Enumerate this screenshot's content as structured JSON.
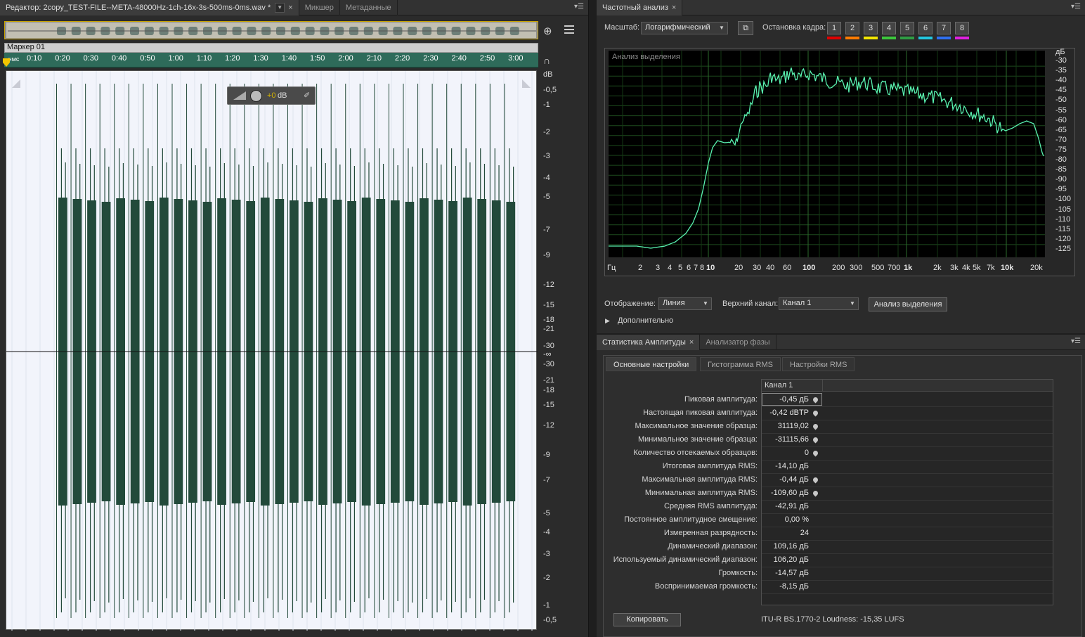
{
  "editor": {
    "tab_title": "Редактор: 2copy_TEST-FILE--META-48000Hz-1ch-16x-3s-500ms-0ms.wav *",
    "tabs": [
      "Микшер",
      "Метаданные"
    ],
    "marker": "Маркер 01",
    "time_unit": "чмс",
    "time_ticks": [
      "0:10",
      "0:20",
      "0:30",
      "0:40",
      "0:50",
      "1:00",
      "1:10",
      "1:20",
      "1:30",
      "1:40",
      "1:50",
      "2:00",
      "2:10",
      "2:20",
      "2:30",
      "2:40",
      "2:50",
      "3:00"
    ],
    "db_unit": "dB",
    "db_ticks": [
      "-0,5",
      "-1",
      "-2",
      "-3",
      "-4",
      "-5",
      "-7",
      "-9",
      "-12",
      "-15",
      "-18",
      "-21",
      "-30",
      "-∞",
      "-30",
      "-21",
      "-18",
      "-15",
      "-12",
      "-9",
      "-7",
      "-5",
      "-4",
      "-3",
      "-2",
      "-1",
      "-0,5"
    ],
    "hud_value": "+0",
    "hud_unit": "dB",
    "waveform_color": "#234a3b",
    "timeline_color": "#2e6b5a"
  },
  "freq": {
    "tab": "Частотный анализ",
    "scale_label": "Масштаб:",
    "scale_value": "Логарифмический",
    "freeze_label": "Остановка кадра:",
    "freeze_buttons": [
      "1",
      "2",
      "3",
      "4",
      "5",
      "6",
      "7",
      "8"
    ],
    "freeze_colors": [
      "#e00000",
      "#ff7b00",
      "#f2e600",
      "#3cc83c",
      "#2f9e44",
      "#22c7e0",
      "#2f6ff0",
      "#e020e0"
    ],
    "plot_title": "Анализ выделения",
    "y_unit": "дБ",
    "y_ticks": [
      "-30",
      "-35",
      "-40",
      "-45",
      "-50",
      "-55",
      "-60",
      "-65",
      "-70",
      "-75",
      "-80",
      "-85",
      "-90",
      "-95",
      "-100",
      "-105",
      "-110",
      "-115",
      "-120",
      "-125"
    ],
    "x_unit": "Гц",
    "x_ticks": [
      "2",
      "3",
      "4",
      "5",
      "6",
      "7",
      "8",
      "10",
      "20",
      "30",
      "40",
      "60",
      "100",
      "200",
      "300",
      "500",
      "700",
      "1k",
      "2k",
      "3k",
      "4k",
      "5k",
      "7k",
      "10k",
      "20k"
    ],
    "display_label": "Отображение:",
    "display_value": "Линия",
    "channel_label": "Верхний канал:",
    "channel_value": "Канал 1",
    "analyze_button": "Анализ выделения",
    "advanced": "Дополнительно",
    "line_color": "#59f2b0"
  },
  "stats": {
    "tabs": [
      "Статистика Амплитуды",
      "Анализатор фазы"
    ],
    "subtabs": [
      "Основные настройки",
      "Гистограмма RMS",
      "Настройки RMS"
    ],
    "column": "Канал 1",
    "rows": [
      {
        "label": "Пиковая амплитуда:",
        "value": "-0,45 дБ",
        "dot": true
      },
      {
        "label": "Настоящая пиковая амплитуда:",
        "value": "-0,42 dBTP",
        "dot": true
      },
      {
        "label": "Максимальное значение образца:",
        "value": "31119,02",
        "dot": true
      },
      {
        "label": "Минимальное значение образца:",
        "value": "-31115,66",
        "dot": true
      },
      {
        "label": "Количество отсекаемых образцов:",
        "value": "0",
        "dot": true
      },
      {
        "label": "Итоговая амплитуда RMS:",
        "value": "-14,10 дБ",
        "dot": false
      },
      {
        "label": "Максимальная амплитуда RMS:",
        "value": "-0,44 дБ",
        "dot": true
      },
      {
        "label": "Минимальная амплитуда RMS:",
        "value": "-109,60 дБ",
        "dot": true
      },
      {
        "label": "Средняя RMS амплитуда:",
        "value": "-42,91 дБ",
        "dot": false
      },
      {
        "label": "Постоянное амплитудное смещение:",
        "value": "0,00 %",
        "dot": false
      },
      {
        "label": "Измеренная разрядность:",
        "value": "24",
        "dot": false
      },
      {
        "label": "Динамический диапазон:",
        "value": "109,16 дБ",
        "dot": false
      },
      {
        "label": "Используемый динамический диапазон:",
        "value": "106,20 дБ",
        "dot": false
      },
      {
        "label": "Громкость:",
        "value": "-14,57 дБ",
        "dot": false
      },
      {
        "label": "Воспринимаемая громкость:",
        "value": "-8,15 дБ",
        "dot": false
      }
    ],
    "copy_button": "Копировать",
    "loudness": "ITU-R BS.1770-2 Loudness: -15,35 LUFS"
  }
}
